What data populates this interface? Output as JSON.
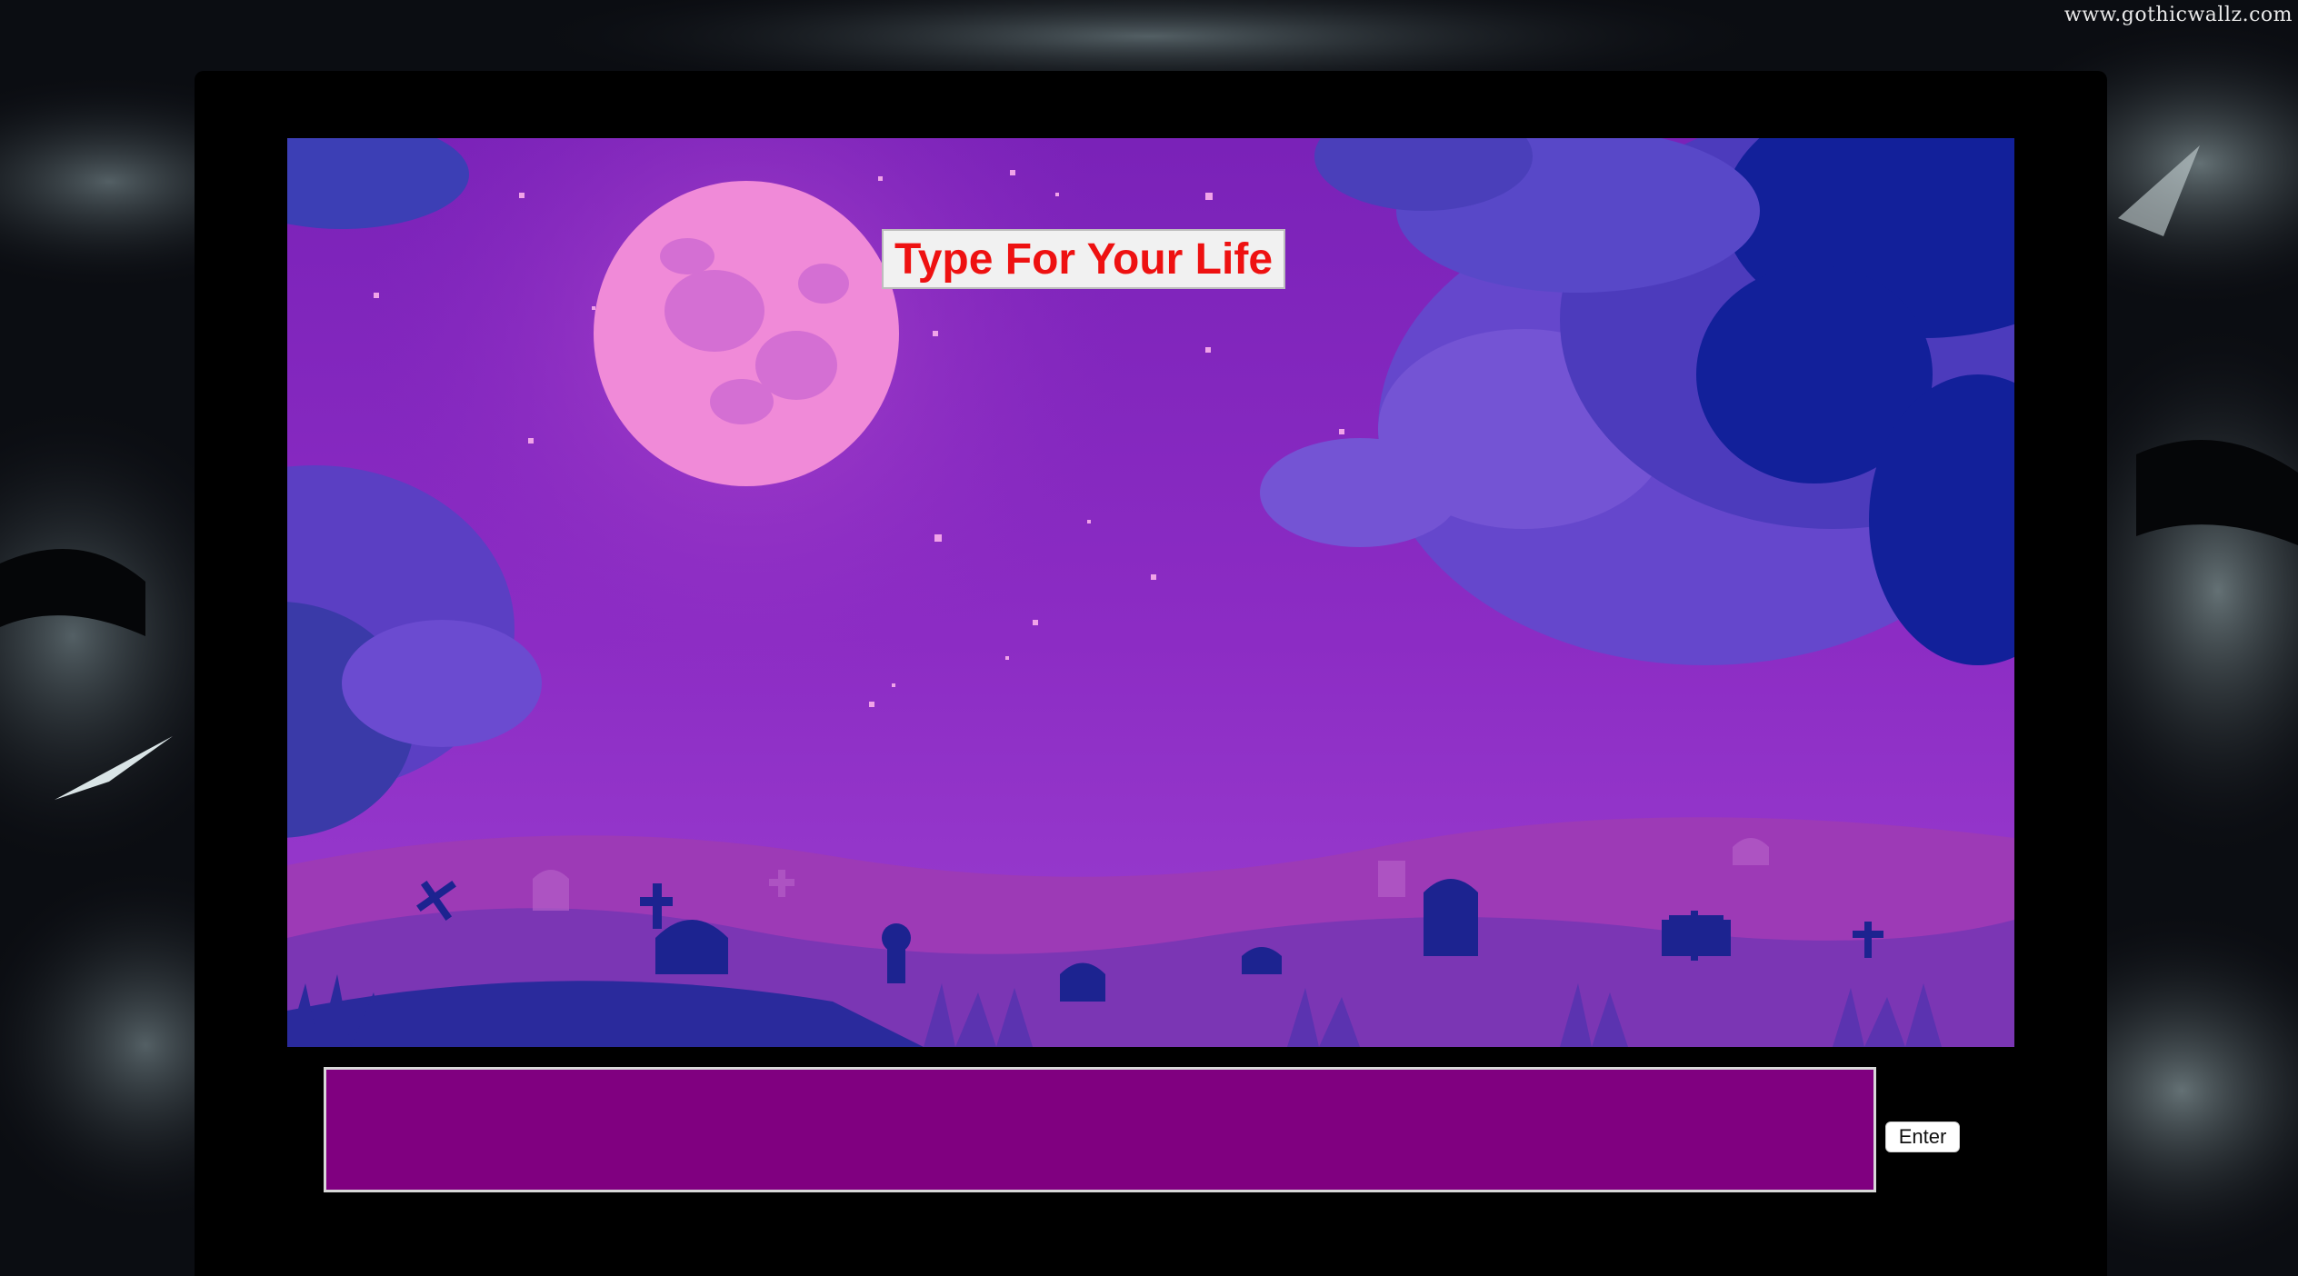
{
  "watermark": "www.gothicwallz.com",
  "game": {
    "title": "Type For Your Life",
    "input_value": "",
    "enter_label": "Enter"
  },
  "colors": {
    "title_text": "#ee1111",
    "input_background": "#800080",
    "sky": "#8a2bc2",
    "moon": "#f08ad8"
  },
  "scene_elements": [
    "full-moon",
    "stars",
    "storm-clouds",
    "graveyard",
    "tombstones",
    "crosses",
    "grass"
  ]
}
